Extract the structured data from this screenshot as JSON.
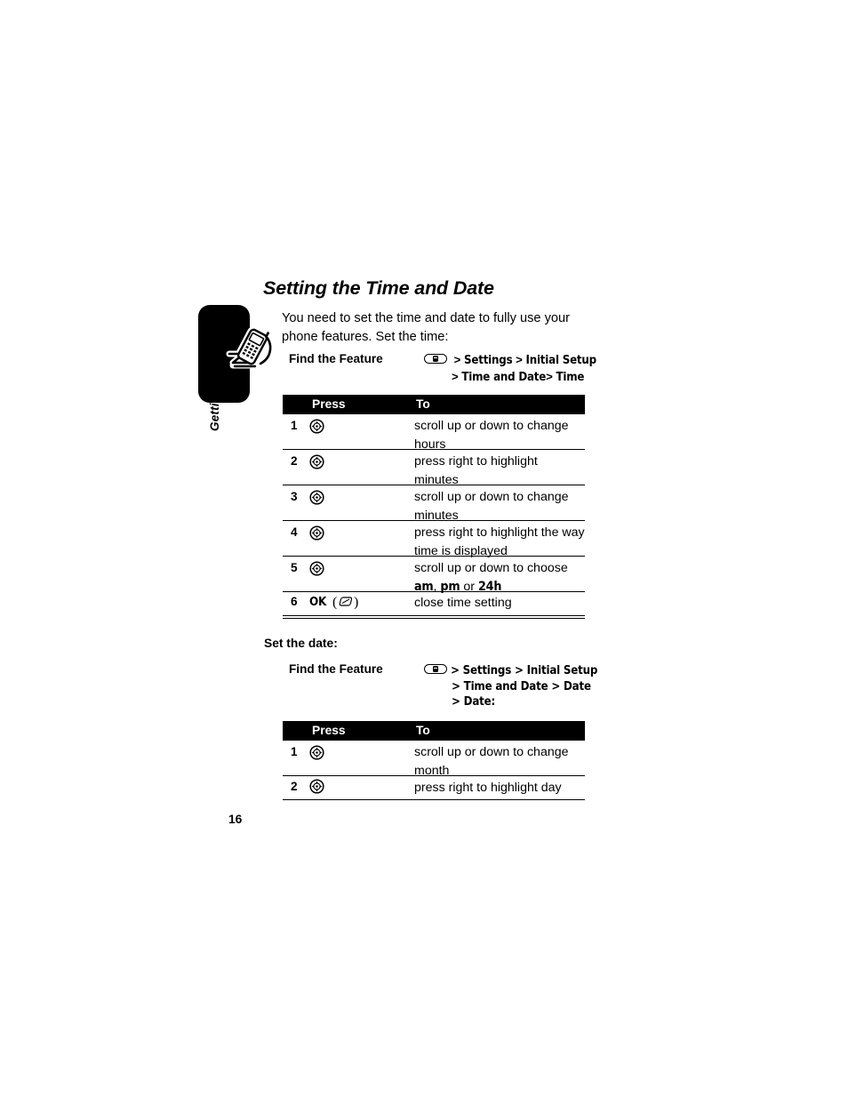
{
  "document": {
    "chapter_tab_label": "Getting Started",
    "page_number": "16",
    "headline": "Setting the Time and Date",
    "intro": "You need to set the time and date to fully use your phone features. Set the time:",
    "subhead_date": "Set the date:"
  },
  "icons": {
    "phone": "phone-icon",
    "menu_key": "menu-key-icon",
    "nav_key": "navigation-key-icon",
    "ok_key": "ok-softkey-icon"
  },
  "find_feature_time": {
    "label": "Find the Feature",
    "path_line1_parts": [
      "Settings",
      "Initial Setup"
    ],
    "path_line2_parts": [
      "Time and Date",
      "Time"
    ],
    "line1": "> Settings > Initial Setup",
    "line2": "> Time and Date> Time"
  },
  "find_feature_date": {
    "label": "Find the Feature",
    "line1": "> Settings > Initial Setup",
    "line2": "> Time and Date > Date",
    "line3": "> Date:"
  },
  "time_table": {
    "headers": {
      "press": "Press",
      "to": "To"
    },
    "rows": [
      {
        "num": "1",
        "key": "nav-key",
        "desc": "scroll up or down to change hours"
      },
      {
        "num": "2",
        "key": "nav-key",
        "desc": "press right to highlight minutes"
      },
      {
        "num": "3",
        "key": "nav-key",
        "desc": "scroll up or down to change minutes"
      },
      {
        "num": "4",
        "key": "nav-key",
        "desc": "press right to highlight the way time is displayed"
      },
      {
        "num": "5",
        "key": "nav-key",
        "desc": "scroll up or down to choose",
        "desc_extra": "am, pm or 24h",
        "desc_parts": [
          "am",
          "pm",
          "24h"
        ]
      },
      {
        "num": "6",
        "key": "ok-key",
        "key_label": "OK",
        "desc": "close time setting"
      }
    ]
  },
  "date_table": {
    "headers": {
      "press": "Press",
      "to": "To"
    },
    "rows": [
      {
        "num": "1",
        "key": "nav-key",
        "desc": "scroll up or down to change month"
      },
      {
        "num": "2",
        "key": "nav-key",
        "desc": "press right to highlight day"
      }
    ]
  },
  "colors": {
    "ink": "#000000",
    "paper": "#ffffff",
    "header_bar": "#000000",
    "header_text": "#ffffff"
  }
}
